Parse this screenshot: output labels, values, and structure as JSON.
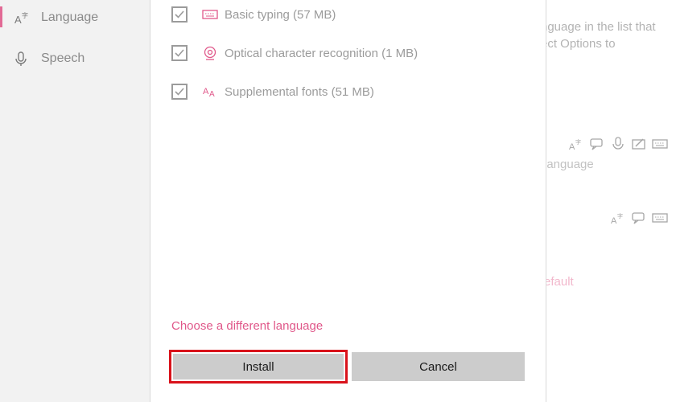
{
  "nav": {
    "items": [
      {
        "label": "Language",
        "icon": "language-icon",
        "selected": true
      },
      {
        "label": "Speech",
        "icon": "microphone-icon",
        "selected": false
      }
    ]
  },
  "dialog": {
    "options": [
      {
        "label": "Basic typing (57 MB)",
        "icon": "keyboard-icon",
        "checked": true
      },
      {
        "label": "Optical character recognition (1 MB)",
        "icon": "ocr-camera-icon",
        "checked": true
      },
      {
        "label": "Supplemental fonts (51 MB)",
        "icon": "fonts-icon",
        "checked": true
      }
    ],
    "choose_link": "Choose a different language",
    "install_label": "Install",
    "cancel_label": "Cancel"
  },
  "background": {
    "desc_line1": "nguage in the list that",
    "desc_line2": "ect Options to",
    "lang_link": "language",
    "default_link": "efault"
  },
  "colors": {
    "accent": "#e0588a",
    "highlight_border": "#d9121b",
    "nav_bg": "#f2f2f2",
    "button_bg": "#cccccc"
  }
}
